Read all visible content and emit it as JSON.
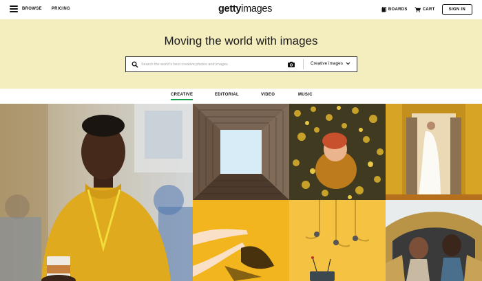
{
  "header": {
    "browse_label": "BROWSE",
    "pricing_label": "PRICING",
    "logo_bold": "getty",
    "logo_light": "images",
    "boards_label": "BOARDS",
    "cart_label": "CART",
    "signin_label": "SIGN IN"
  },
  "hero": {
    "title": "Moving the world with images",
    "search_placeholder": "Search the world's best creative photos and images",
    "filter_label": "Creative images"
  },
  "tabs": [
    {
      "label": "CREATIVE",
      "active": true
    },
    {
      "label": "EDITORIAL",
      "active": false
    },
    {
      "label": "VIDEO",
      "active": false
    },
    {
      "label": "MUSIC",
      "active": false
    }
  ],
  "colors": {
    "hero_bg": "#f4eebf",
    "active_tab_underline": "#15a04b"
  },
  "icons": [
    "hamburger-icon",
    "boards-icon",
    "cart-icon",
    "search-icon",
    "camera-icon",
    "chevron-down-icon"
  ],
  "images": [
    "portrait-woman-yellow-sweater",
    "looking-up-courtyard",
    "boy-in-autumn-leaves",
    "bride-in-doorway",
    "hands-on-yellow",
    "yellow-abstract-installation",
    "friends-on-ride"
  ]
}
